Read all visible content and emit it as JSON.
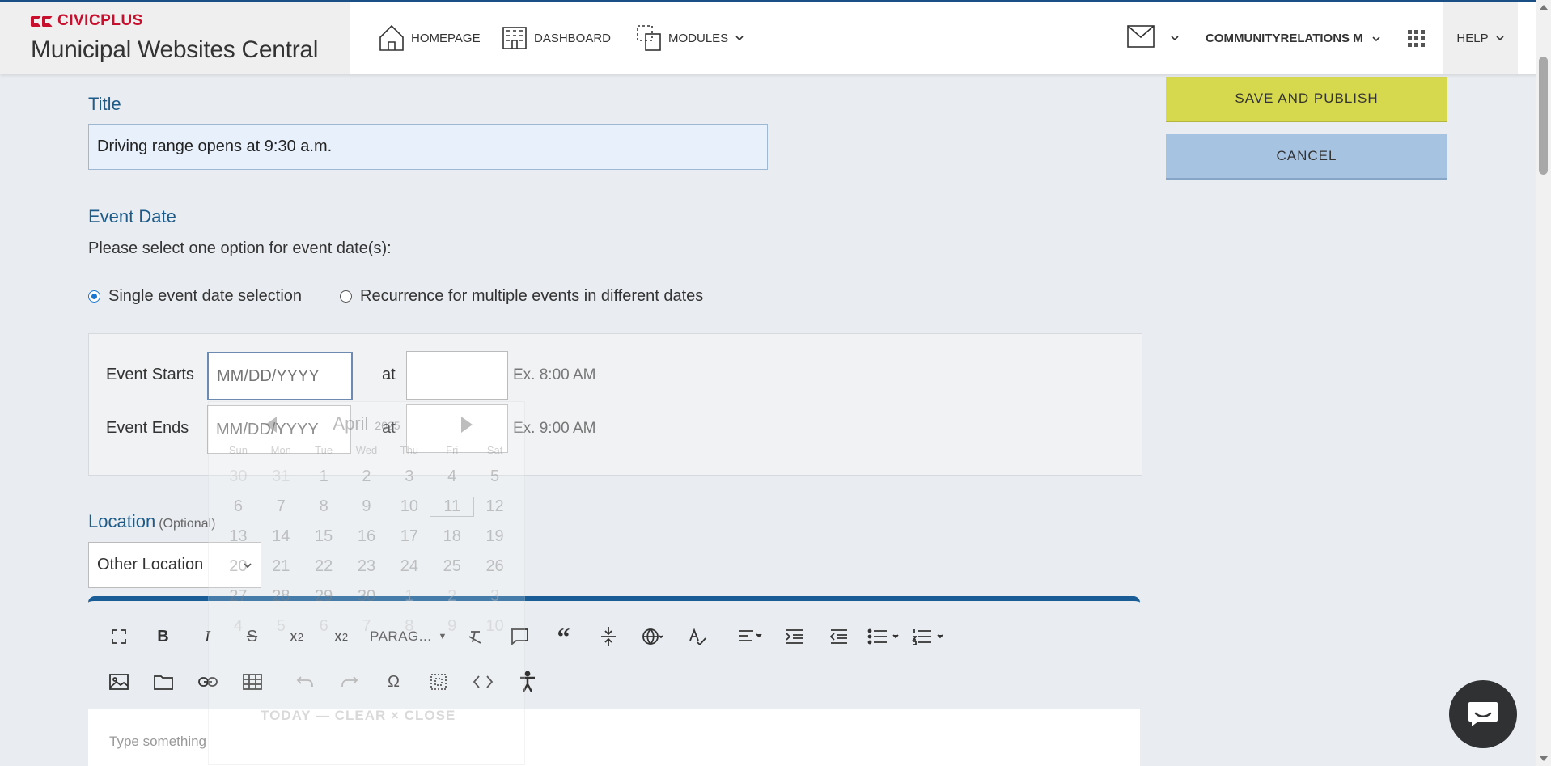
{
  "brand": {
    "logo_text": "CIVICPLUS",
    "title": "Municipal Websites Central"
  },
  "nav": {
    "homepage": "HOMEPAGE",
    "dashboard": "DASHBOARD",
    "modules": "MODULES"
  },
  "header": {
    "user": "COMMUNITYRELATIONS M",
    "help": "HELP"
  },
  "form": {
    "title_label": "Title",
    "title_value": "Driving range opens at 9:30 a.m.",
    "event_date_label": "Event Date",
    "event_date_instruction": "Please select one option for event date(s):",
    "radio_single": "Single event date selection",
    "radio_recurrence": "Recurrence for multiple events in different dates",
    "event_starts_label": "Event Starts",
    "event_ends_label": "Event Ends",
    "date_placeholder": "MM/DD/YYYY",
    "at_label": "at",
    "start_example": "Ex. 8:00 AM",
    "end_example": "Ex. 9:00 AM",
    "location_label": "Location",
    "location_optional": "(Optional)",
    "location_value": "Other Location",
    "editor_placeholder": "Type something",
    "paragraph_format": "PARAG..."
  },
  "datepicker": {
    "month": "April",
    "year": "2025",
    "dow": [
      "Sun",
      "Mon",
      "Tue",
      "Wed",
      "Thu",
      "Fri",
      "Sat"
    ],
    "footer": "TODAY — CLEAR × CLOSE",
    "selected_day": "11"
  },
  "actions": {
    "save_publish": "SAVE AND PUBLISH",
    "cancel": "CANCEL"
  },
  "colors": {
    "accent_blue": "#1a5d96",
    "publish": "#d6d84d",
    "cancel": "#a7c3e2",
    "brand_red": "#c8102e"
  }
}
